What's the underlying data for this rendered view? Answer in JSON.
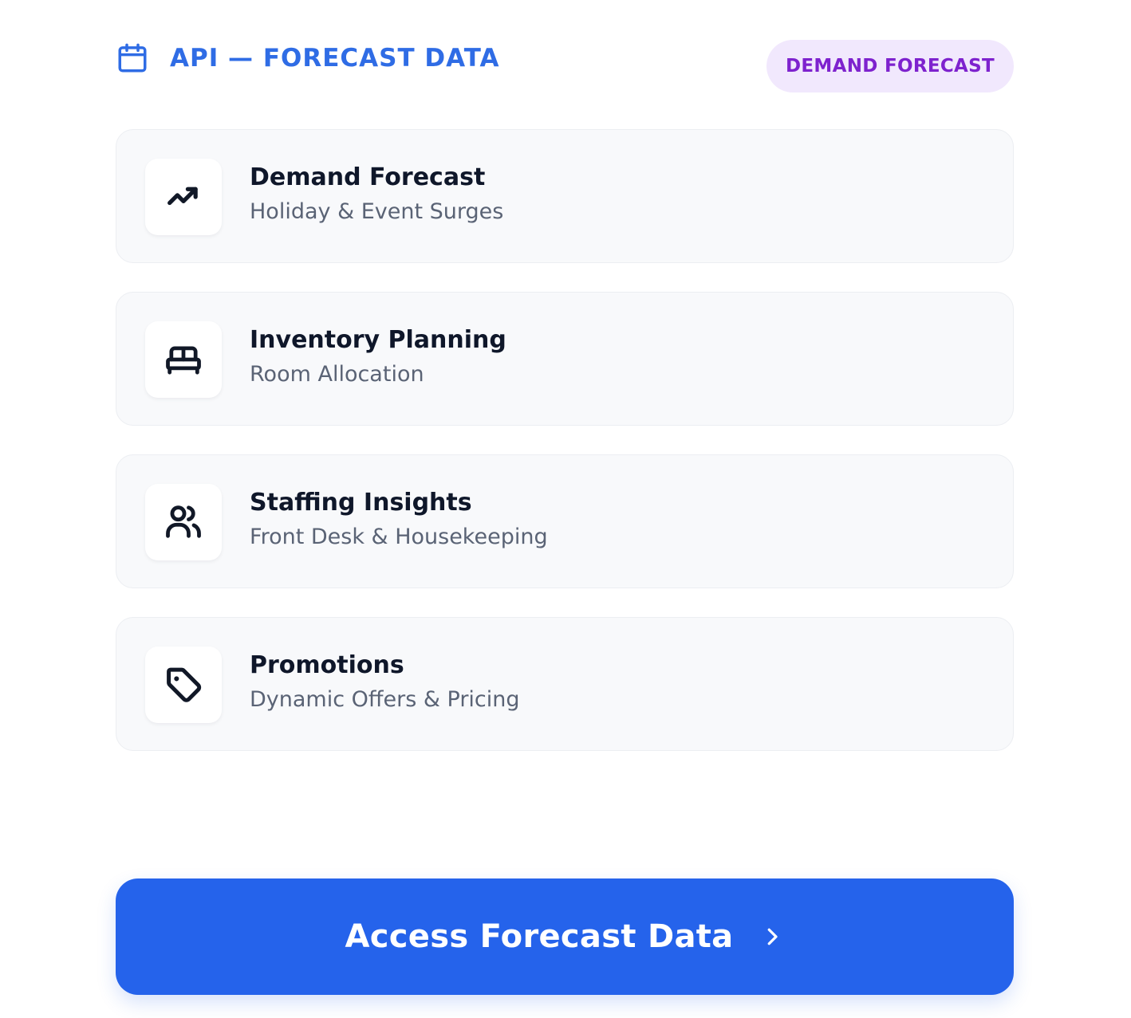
{
  "header": {
    "title": "API — FORECAST DATA",
    "badge": "DEMAND FORECAST",
    "icon": "calendar-icon",
    "accent_color": "#2f6ce5",
    "badge_color": "#7e22ce",
    "badge_background": "#f1e8fd"
  },
  "cards": [
    {
      "title": "Demand Forecast",
      "subtitle": "Holiday & Event Surges",
      "icon": "trending-up-icon"
    },
    {
      "title": "Inventory Planning",
      "subtitle": "Room Allocation",
      "icon": "bed-icon"
    },
    {
      "title": "Staffing Insights",
      "subtitle": "Front Desk & Housekeeping",
      "icon": "users-icon"
    },
    {
      "title": "Promotions",
      "subtitle": "Dynamic Offers & Pricing",
      "icon": "tag-icon"
    }
  ],
  "cta": {
    "label": "Access Forecast Data",
    "icon": "chevron-right-icon",
    "background": "#2563eb"
  }
}
